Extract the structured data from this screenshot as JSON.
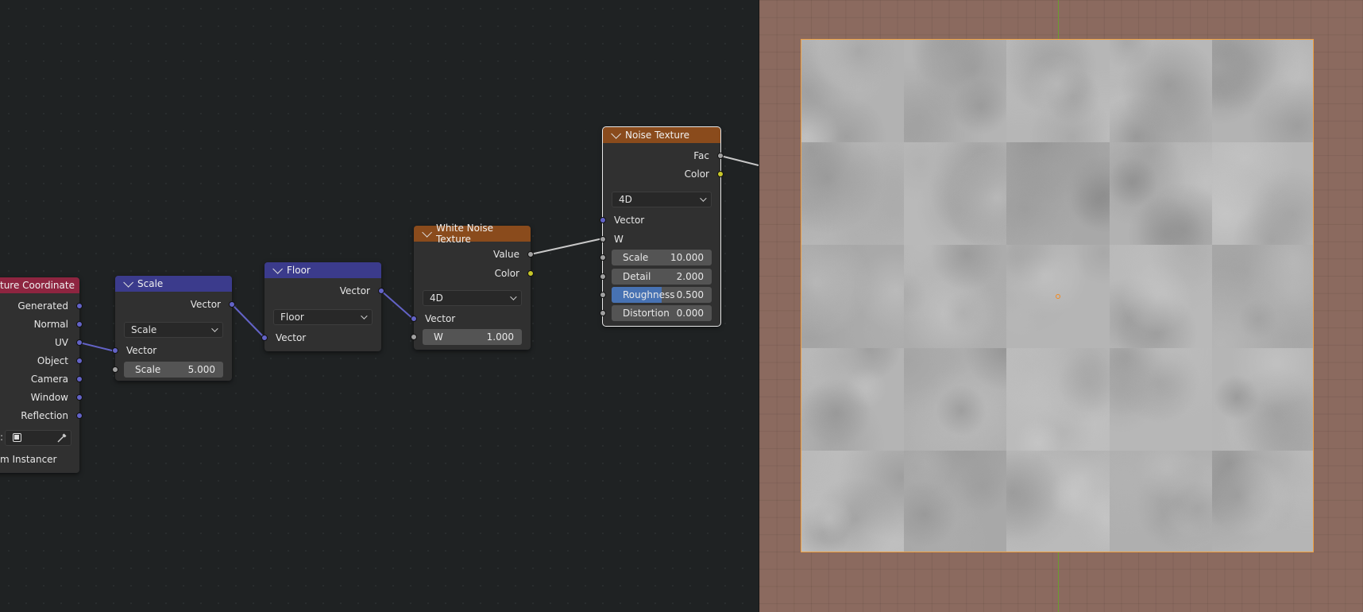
{
  "nodes": {
    "tex_coord": {
      "title": "ture Coordinate",
      "outputs": [
        "Generated",
        "Normal",
        "UV",
        "Object",
        "Camera",
        "Window",
        "Reflection"
      ],
      "object_prefix": ":",
      "instancer_label": "m Instancer"
    },
    "scale": {
      "title": "Scale",
      "output": "Vector",
      "operation": "Scale",
      "input_vector": "Vector",
      "scale_label": "Scale",
      "scale_value": "5.000"
    },
    "floor": {
      "title": "Floor",
      "output": "Vector",
      "operation": "Floor",
      "input_vector": "Vector"
    },
    "white_noise": {
      "title": "White Noise Texture",
      "outputs": [
        "Value",
        "Color"
      ],
      "dimensions": "4D",
      "input_vector": "Vector",
      "w_label": "W",
      "w_value": "1.000"
    },
    "noise": {
      "title": "Noise Texture",
      "outputs": [
        "Fac",
        "Color"
      ],
      "dimensions": "4D",
      "inputs": [
        "Vector",
        "W"
      ],
      "fields": [
        {
          "label": "Scale",
          "value": "10.000"
        },
        {
          "label": "Detail",
          "value": "2.000"
        },
        {
          "label": "Roughness",
          "value": "0.500",
          "fill": 0.5
        },
        {
          "label": "Distortion",
          "value": "0.000"
        }
      ]
    }
  },
  "colors": {
    "vector_header": "#3b3b8c",
    "texture_header": "#8a4b1c",
    "input_header": "#8e2540",
    "vector_socket": "#6363c7",
    "float_socket": "#a1a1a1",
    "color_socket": "#c7c729",
    "viewport_bg": "#8b6a5f",
    "selection": "#f0a040"
  }
}
